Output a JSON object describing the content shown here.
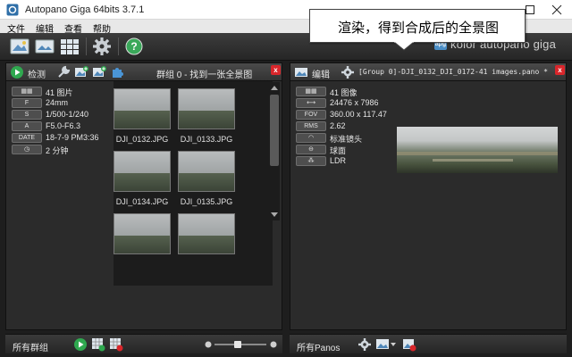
{
  "window": {
    "title": "Autopano Giga 64bits 3.7.1"
  },
  "menu": [
    "文件",
    "编辑",
    "查看",
    "帮助"
  ],
  "toolbar": {
    "buttons": [
      "import-images-icon",
      "detect-icon",
      "batch-icon",
      "settings-gear-icon",
      "help-icon"
    ]
  },
  "brand": {
    "logo": "apg",
    "name": "kolor autopano giga"
  },
  "callout": {
    "text": "渲染，得到合成后的全景图"
  },
  "left_panel": {
    "detect_label": "检测",
    "group_title": "群组 0 - 找到一张全景图",
    "info": [
      {
        "badge": "",
        "value": "41 图片",
        "icon": "images-icon"
      },
      {
        "badge": "F",
        "value": "24mm"
      },
      {
        "badge": "S",
        "value": "1/500-1/240"
      },
      {
        "badge": "A",
        "value": "F5.0-F6.3"
      },
      {
        "badge": "DATE",
        "value": "18-7-9 PM3:36"
      },
      {
        "badge": "",
        "value": "2 分钟",
        "icon": "clock-icon"
      }
    ],
    "thumbnails": [
      "DJI_0132.JPG",
      "DJI_0133.JPG",
      "DJI_0134.JPG",
      "DJI_0135.JPG"
    ]
  },
  "right_panel": {
    "edit_label": "编辑",
    "pano_title": "[Group 0]-DJI_0132_DJI_0172-41 images.pano *",
    "info": [
      {
        "badge": "",
        "value": "41 图像",
        "icon": "images-icon"
      },
      {
        "badge": "",
        "value": "24476 x 7986",
        "icon": "width-arrows-icon"
      },
      {
        "badge": "FOV",
        "value": "360.00 x 117.47"
      },
      {
        "badge": "RMS",
        "value": "2.62"
      },
      {
        "badge": "",
        "value": "标准镜头",
        "icon": "lens-icon"
      },
      {
        "badge": "",
        "value": "球面",
        "icon": "sphere-projection-icon"
      },
      {
        "badge": "",
        "value": "LDR",
        "icon": "ldr-icon"
      }
    ]
  },
  "bottom": {
    "left_label": "所有群组",
    "right_label": "所有Panos"
  },
  "colors": {
    "accent_green": "#2fa84f",
    "close_red": "#d9262b",
    "panel_bg": "#2b2b2b"
  }
}
